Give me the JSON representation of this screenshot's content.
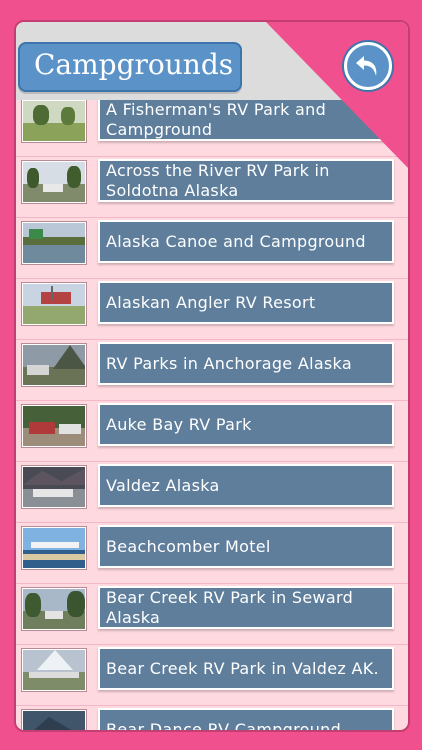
{
  "header": {
    "title": "Campgrounds",
    "back_icon": "back-arrow-icon"
  },
  "colors": {
    "background": "#f0508e",
    "panel": "#ffd9e0",
    "label_box": "#5e7e9c",
    "title_tab": "#5b93c9"
  },
  "items": [
    {
      "label": "A Fisherman's RV Park and Campground"
    },
    {
      "label": "Across the River RV Park in Soldotna Alaska"
    },
    {
      "label": "Alaska Canoe and Campground"
    },
    {
      "label": "Alaskan Angler RV Resort"
    },
    {
      "label": "RV Parks in Anchorage Alaska"
    },
    {
      "label": "Auke Bay RV Park"
    },
    {
      "label": "Valdez Alaska"
    },
    {
      "label": "Beachcomber Motel"
    },
    {
      "label": "Bear Creek RV Park in Seward Alaska"
    },
    {
      "label": "Bear Creek RV Park in Valdez AK."
    },
    {
      "label": "Bear Dance RV Campground"
    }
  ]
}
